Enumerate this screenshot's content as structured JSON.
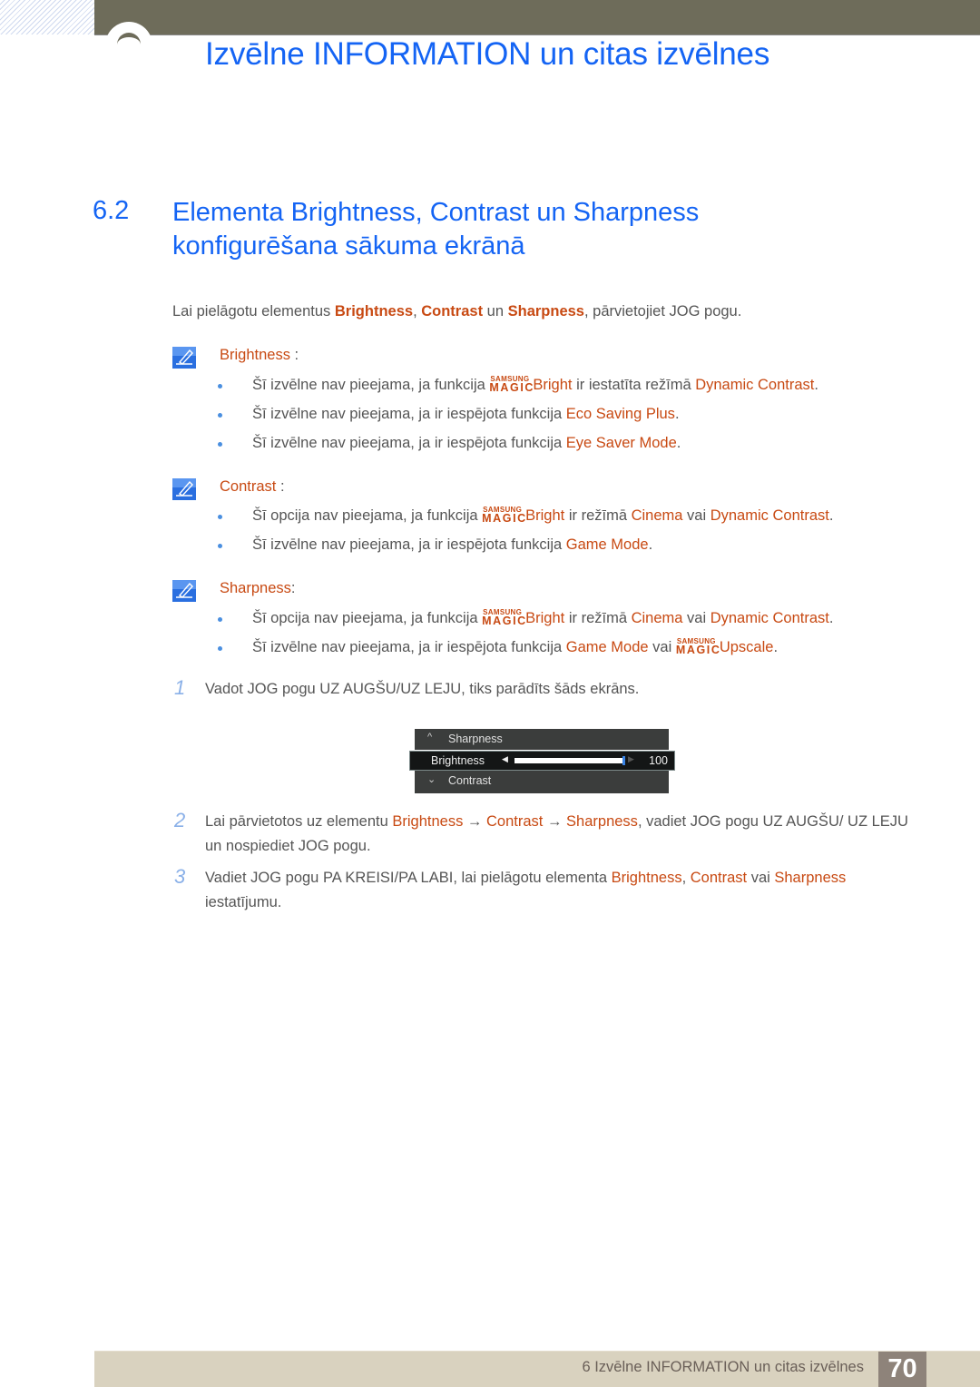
{
  "header": {
    "chapter_title": "Izvēlne INFORMATION un citas izvēlnes"
  },
  "section": {
    "number": "6.2",
    "title_line1": "Elementa Brightness, Contrast un Sharpness",
    "title_line2": "konfigurēšana sākuma ekrānā"
  },
  "intro": {
    "prefix": "Lai pielāgotu elementus ",
    "term1": "Brightness",
    "sep1": ", ",
    "term2": "Contrast",
    "sep2": " un ",
    "term3": "Sharpness",
    "suffix": ", pārvietojiet JOG pogu."
  },
  "magic_logo": {
    "top": "SAMSUNG",
    "bottom": "MAGIC"
  },
  "notes": [
    {
      "label": "Brightness",
      "label_suffix": " :",
      "bullets": [
        {
          "pre": "Šī izvēlne nav pieejama, ja funkcija ",
          "magic_term": "Bright",
          "mid": " ir iestatīta režīmā ",
          "term": "Dynamic Contrast",
          "post": "."
        },
        {
          "pre": "Šī izvēlne nav pieejama, ja ir iespējota funkcija ",
          "term": "Eco Saving Plus",
          "post": "."
        },
        {
          "pre": "Šī izvēlne nav pieejama, ja ir iespējota funkcija ",
          "term": "Eye Saver Mode",
          "post": "."
        }
      ]
    },
    {
      "label": "Contrast",
      "label_suffix": " :",
      "bullets": [
        {
          "pre": "Šī opcija nav pieejama, ja funkcija ",
          "magic_term": "Bright",
          "mid": " ir režīmā ",
          "term": "Cinema",
          "mid2": " vai ",
          "term2": "Dynamic Contrast",
          "post": "."
        },
        {
          "pre": "Šī izvēlne nav pieejama, ja ir iespējota funkcija ",
          "term": "Game Mode",
          "post": "."
        }
      ]
    },
    {
      "label": "Sharpness",
      "label_suffix": ":",
      "bullets": [
        {
          "pre": "Šī opcija nav pieejama, ja funkcija ",
          "magic_term": "Bright",
          "mid": " ir režīmā ",
          "term": "Cinema",
          "mid2": " vai ",
          "term2": "Dynamic Contrast",
          "post": "."
        },
        {
          "pre": "Šī izvēlne nav pieejama, ja ir iespējota funkcija ",
          "term": "Game Mode",
          "mid": " vai ",
          "magic_term": "Upscale",
          "post": "."
        }
      ]
    }
  ],
  "steps": [
    {
      "num": "1",
      "text": "Vadot JOG pogu UZ AUGŠU/UZ LEJU, tiks parādīts šāds ekrāns."
    },
    {
      "num": "2",
      "pre": "Lai pārvietotos uz elementu ",
      "t1": "Brightness",
      "a1": " → ",
      "t2": "Contrast",
      "a2": " → ",
      "t3": "Sharpness",
      "post": ", vadiet JOG pogu UZ AUGŠU/ UZ LEJU un nospiediet JOG pogu."
    },
    {
      "num": "3",
      "pre": "Vadiet JOG pogu PA KREISI/PA LABI, lai pielāgotu elementa ",
      "t1": "Brightness",
      "s1": ", ",
      "t2": "Contrast",
      "s2": " vai ",
      "t3": "Sharpness",
      "post": " iestatījumu."
    }
  ],
  "osd": {
    "up_item": "Sharpness",
    "selected_item": "Brightness",
    "down_item": "Contrast",
    "value": "100",
    "value_fraction": 1.0,
    "up_icon": "^",
    "down_icon": "⌄",
    "left_arrow": "◀",
    "right_arrow": "▶"
  },
  "footer": {
    "text": "6 Izvēlne INFORMATION un citas izvēlnes",
    "page": "70"
  },
  "colors": {
    "heading_blue": "#1464f4",
    "term_orange": "#c84a13",
    "topbar": "#6e6c5a",
    "footer_bg": "#d9d2bf",
    "page_badge": "#8e837a"
  }
}
